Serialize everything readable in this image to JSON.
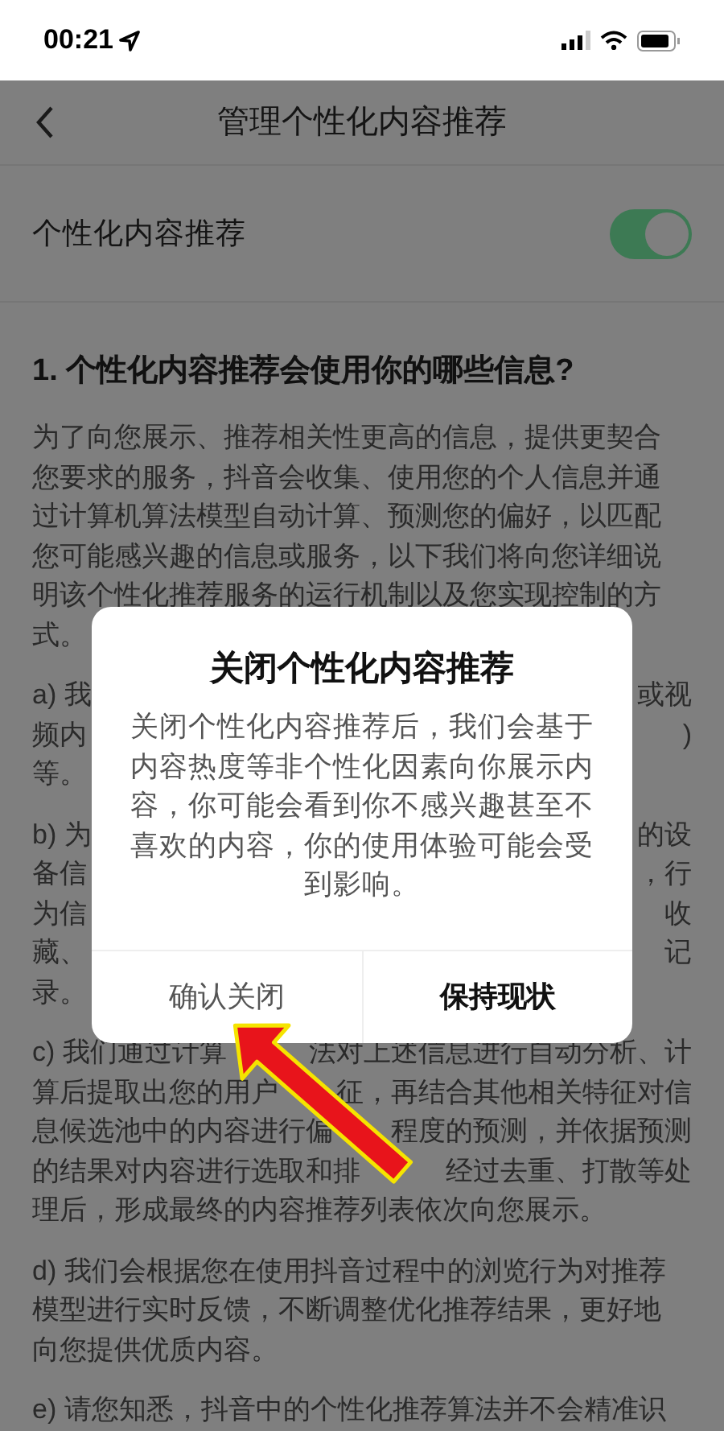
{
  "status_bar": {
    "time": "00:21"
  },
  "nav": {
    "title": "管理个性化内容推荐"
  },
  "toggle_row": {
    "label": "个性化内容推荐",
    "on": true
  },
  "section_heading": "1. 个性化内容推荐会使用你的哪些信息?",
  "paragraphs": [
    {
      "text": "为了向您展示、推荐相关性更高的信息，提供更契合您要求的服务，抖音会收集、使用您的个人信息并通过计算机算法模型自动计算、预测您的偏好，以匹配您可能感兴趣的信息或服务，以下我们将向您详细说明该个性化推荐服务的运行机制以及您实现控制的方式。"
    },
    {
      "lines": [
        [
          "a) 我",
          "或视"
        ],
        [
          "频内",
          ")"
        ],
        [
          "等。"
        ]
      ]
    },
    {
      "lines": [
        [
          "b) 为",
          "的设"
        ],
        [
          "备信",
          "，行"
        ],
        [
          "为信",
          "收"
        ],
        [
          "藏、",
          "记"
        ],
        [
          "录。"
        ]
      ]
    },
    {
      "lines": [
        [
          "c) 我们通过计算",
          "法对上述信息进行自动分析、计"
        ],
        [
          "算后提取出您的用户",
          "征，再结合其他相关特征对信"
        ],
        [
          "息候选池中的内容进行偏",
          "程度的预测，并依据预测"
        ],
        [
          "的结果对内容进行选取和排",
          "经过去重、打散等处"
        ],
        [
          "理后，形成最终的内容推荐列表依次向您展示。"
        ]
      ]
    },
    {
      "text": "d) 我们会根据您在使用抖音过程中的浏览行为对推荐模型进行实时反馈，不断调整优化推荐结果，更好地向您提供优质内容。"
    },
    {
      "lines": [
        [
          "e) 请您知悉，抖音中的个性化推荐算法并不会精准识"
        ]
      ]
    }
  ],
  "dialog": {
    "title": "关闭个性化内容推荐",
    "message": "关闭个性化内容推荐后，我们会基于内容热度等非个性化因素向你展示内容，你可能会看到你不感兴趣甚至不喜欢的内容，你的使用体验可能会受到影响。",
    "buttons": [
      {
        "label": "确认关闭",
        "kind": "secondary"
      },
      {
        "label": "保持现状",
        "kind": "primary"
      }
    ]
  }
}
